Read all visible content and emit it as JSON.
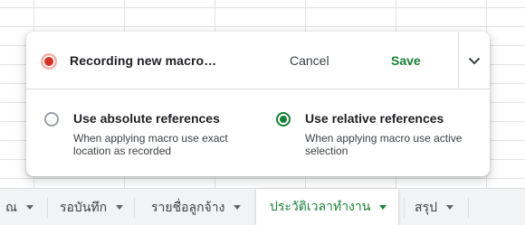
{
  "dialog": {
    "recording_title": "Recording new macro…",
    "cancel_label": "Cancel",
    "save_label": "Save",
    "options": {
      "absolute": {
        "title": "Use absolute references",
        "desc_line1": "When applying macro use exact",
        "desc_line2": "location as recorded",
        "selected": false
      },
      "relative": {
        "title": "Use relative references",
        "desc_line1": "When applying macro use active",
        "desc_line2": "selection",
        "selected": true
      }
    }
  },
  "sheet_tabs": [
    {
      "label": "ณ"
    },
    {
      "label": "รอบันทึก"
    },
    {
      "label": "รายชื่อลูกจ้าง"
    },
    {
      "label": "ประวัติเวลาทำงาน",
      "active": true
    },
    {
      "label": "สรุป"
    }
  ],
  "colors": {
    "accent_green": "#188038",
    "record_red": "#d93025"
  },
  "icons": {
    "record": "record-dot-icon",
    "expand": "chevron-down-icon",
    "tab_menu": "caret-down-icon"
  }
}
